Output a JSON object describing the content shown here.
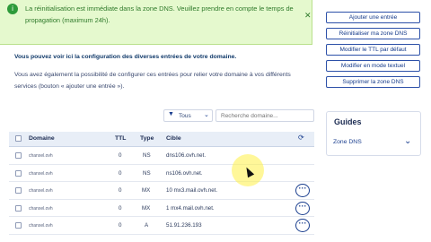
{
  "alert": {
    "text": "La réinitialisation est immédiate dans la zone DNS. Veuillez prendre en compte le temps de propagation (maximum 24h)."
  },
  "intro": "Vous pouvez voir ici la configuration des diverses entrées de votre domaine.",
  "description": "Vous avez également la possibilité de configurer ces entrées pour relier votre domaine à vos différents services (bouton « ajouter une entrée »).",
  "actions": [
    "Ajouter une entrée",
    "Réinitialiser ma zone DNS",
    "Modifier le TTL par défaut",
    "Modifier en mode textuel",
    "Supprimer la zone DNS"
  ],
  "guides": {
    "title": "Guides",
    "item": "Zone DNS"
  },
  "filter": {
    "label": "Tous",
    "search_placeholder": "Recherche domaine..."
  },
  "table": {
    "headers": {
      "domain": "Domaine",
      "ttl": "TTL",
      "type": "Type",
      "target": "Cible"
    },
    "rows": [
      {
        "domain": "chanxel.ovh",
        "ttl": "0",
        "type": "NS",
        "target": "dns106.ovh.net."
      },
      {
        "domain": "chanxel.ovh",
        "ttl": "0",
        "type": "NS",
        "target": "ns106.ovh.net."
      },
      {
        "domain": "chanxel.ovh",
        "ttl": "0",
        "type": "MX",
        "target": "10 mx3.mail.ovh.net."
      },
      {
        "domain": "chanxel.ovh",
        "ttl": "0",
        "type": "MX",
        "target": "1 mx4.mail.ovh.net."
      },
      {
        "domain": "chanxel.ovh",
        "ttl": "0",
        "type": "A",
        "target": "51.91.236.193"
      }
    ]
  }
}
